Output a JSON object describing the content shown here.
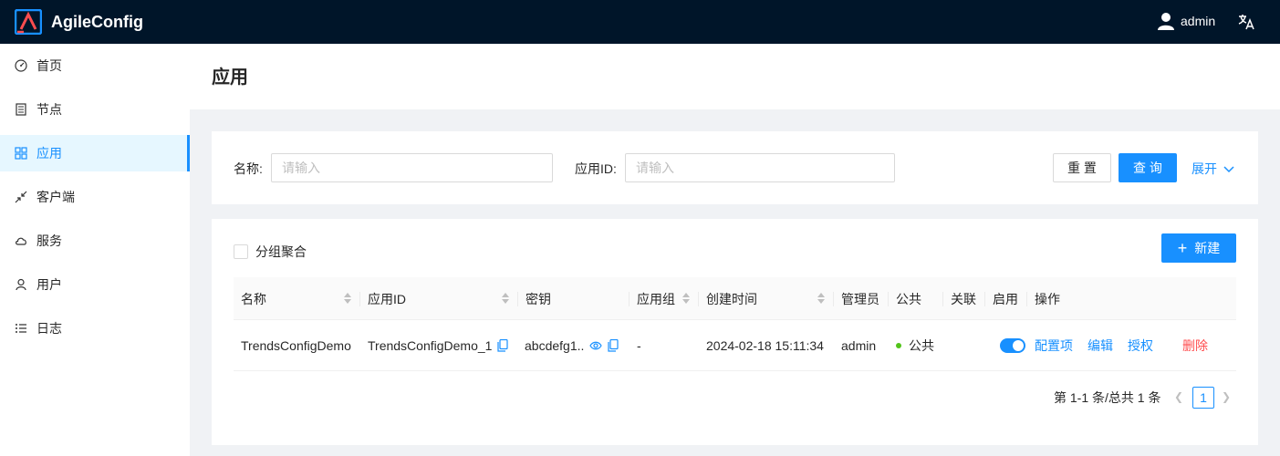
{
  "app": {
    "title": "AgileConfig"
  },
  "header": {
    "user_name": "admin"
  },
  "sidebar": {
    "items": [
      {
        "label": "首页",
        "icon": "dashboard-icon"
      },
      {
        "label": "节点",
        "icon": "node-icon"
      },
      {
        "label": "应用",
        "icon": "apps-icon",
        "active": true
      },
      {
        "label": "客户端",
        "icon": "shrink-icon"
      },
      {
        "label": "服务",
        "icon": "cloud-icon"
      },
      {
        "label": "用户",
        "icon": "user-icon"
      },
      {
        "label": "日志",
        "icon": "list-icon"
      }
    ]
  },
  "page": {
    "title": "应用"
  },
  "search": {
    "name_label": "名称:",
    "name_placeholder": "请输入",
    "appid_label": "应用ID:",
    "appid_placeholder": "请输入",
    "reset_label": "重 置",
    "query_label": "查 询",
    "expand_label": "展开"
  },
  "toolbar": {
    "group_checkbox_label": "分组聚合",
    "new_label": "新建"
  },
  "table": {
    "columns": [
      "名称",
      "应用ID",
      "密钥",
      "应用组",
      "创建时间",
      "管理员",
      "公共",
      "关联",
      "启用",
      "操作"
    ],
    "rows": [
      {
        "name": "TrendsConfigDemo",
        "app_id": "TrendsConfigDemo_1",
        "secret": "abcdefg1..",
        "group": "-",
        "created": "2024-02-18 15:11:34",
        "admin": "admin",
        "public": "公共",
        "enabled": true,
        "actions": {
          "config": "配置项",
          "edit": "编辑",
          "auth": "授权",
          "delete": "删除"
        }
      }
    ]
  },
  "pagination": {
    "total_text": "第 1-1 条/总共 1 条",
    "current_page": "1"
  },
  "colors": {
    "primary": "#1890ff",
    "header_bg": "#001529",
    "danger": "#ff4d4f",
    "success": "#52c41a"
  }
}
